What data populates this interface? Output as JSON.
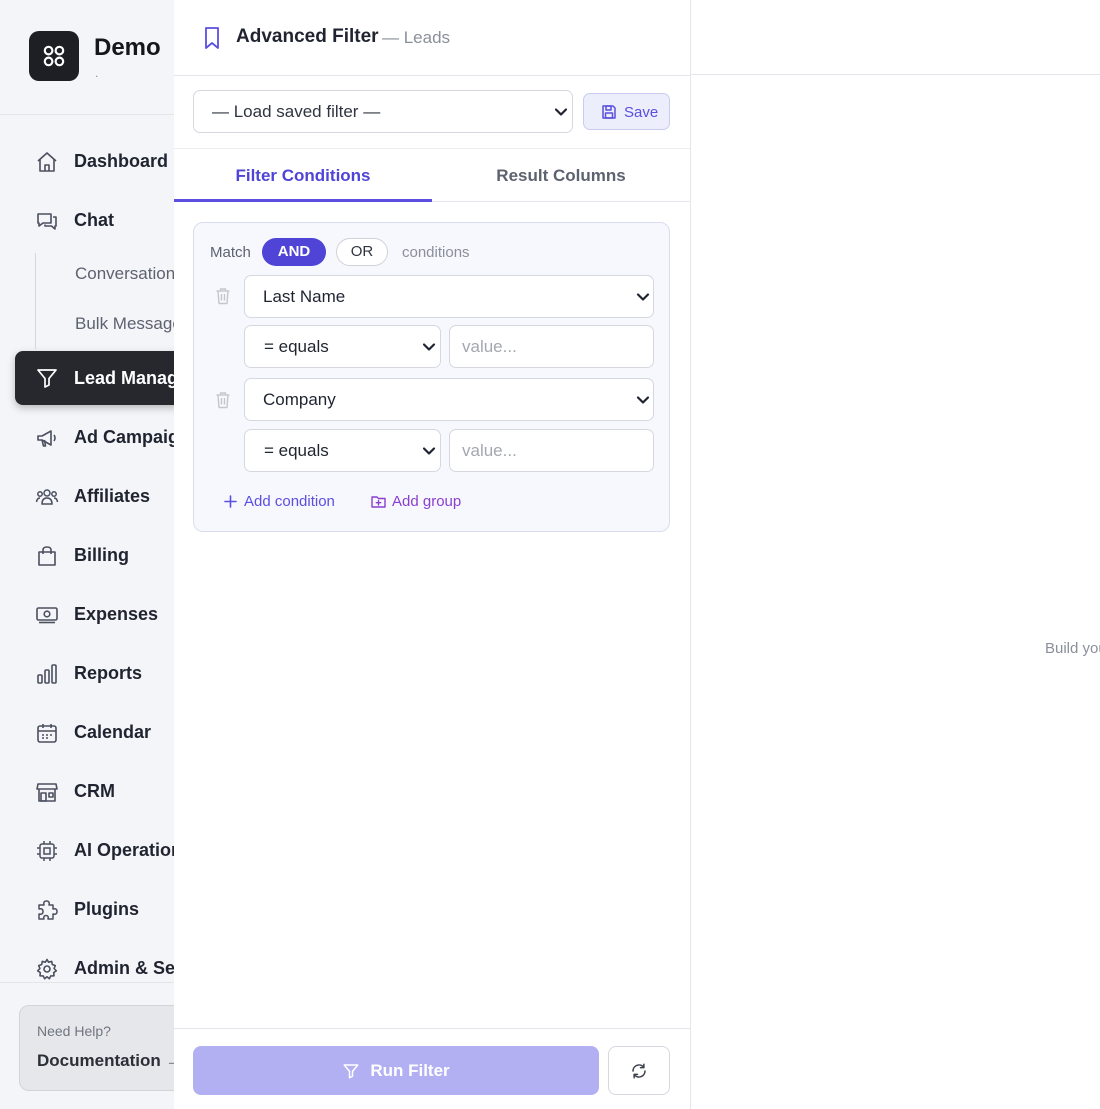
{
  "brand": {
    "name": "Demo",
    "tagline": "."
  },
  "sidebar": {
    "items": [
      {
        "label": "Dashboard",
        "icon": "home-icon"
      },
      {
        "label": "Chat",
        "icon": "chat-bubbles-icon"
      },
      {
        "label": "Lead Management",
        "icon": "funnel-icon",
        "active": true
      },
      {
        "label": "Ad Campaigns",
        "icon": "megaphone-icon"
      },
      {
        "label": "Affiliates",
        "icon": "users-group-icon"
      },
      {
        "label": "Billing",
        "icon": "shopping-bag-icon"
      },
      {
        "label": "Expenses",
        "icon": "banknote-icon"
      },
      {
        "label": "Reports",
        "icon": "bar-chart-icon"
      },
      {
        "label": "Calendar",
        "icon": "calendar-icon"
      },
      {
        "label": "CRM",
        "icon": "storefront-icon"
      },
      {
        "label": "AI Operations",
        "icon": "cpu-chip-icon"
      },
      {
        "label": "Plugins",
        "icon": "puzzle-icon"
      },
      {
        "label": "Admin & Settings",
        "icon": "gear-icon"
      }
    ],
    "chat_subitems": [
      "Conversations",
      "Bulk Messages"
    ],
    "help": {
      "title": "Need Help?",
      "link": "Documentation →"
    }
  },
  "filter_panel": {
    "title": "Advanced Filter",
    "subtitle": "— Leads",
    "saved_filter_placeholder": "— Load saved filter —",
    "save_label": "Save",
    "tabs": [
      {
        "label": "Filter Conditions",
        "active": true
      },
      {
        "label": "Result Columns",
        "active": false
      }
    ],
    "match_label": "Match",
    "match_and": "AND",
    "match_or": "OR",
    "match_selected": "AND",
    "conditions_label": "conditions",
    "conditions": [
      {
        "field": "Last Name",
        "operator": "= equals",
        "value": "",
        "value_placeholder": "value..."
      },
      {
        "field": "Company",
        "operator": "= equals",
        "value": "",
        "value_placeholder": "value..."
      }
    ],
    "add_condition_label": "Add condition",
    "add_group_label": "Add group",
    "run_label": "Run Filter"
  },
  "results": {
    "empty_text": "Build your filter and click Run Filter"
  },
  "colors": {
    "accent": "#5b4ee0",
    "accent_dark": "#4f44d6",
    "run_button_disabled": "#b2b0f3",
    "sidebar_active": "#26282d",
    "add_group": "#8a3fd0"
  }
}
